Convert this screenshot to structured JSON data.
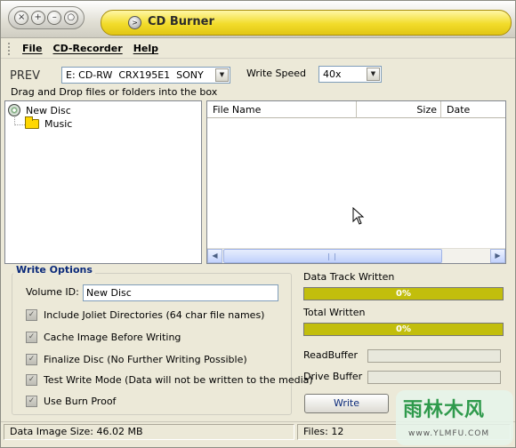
{
  "window": {
    "title": "CD Burner",
    "window_buttons": [
      "×",
      "+",
      "–",
      "○"
    ]
  },
  "menu": [
    "File",
    "CD-Recorder",
    "Help"
  ],
  "toolbar": {
    "prev_label": "PREV",
    "drive": "E: CD-RW  CRX195E1  SONY",
    "write_speed_label": "Write Speed",
    "write_speed": "40x"
  },
  "drag_drop_hint": "Drag and Drop files or folders into the box",
  "tree": {
    "root": "New Disc",
    "children": [
      "Music"
    ]
  },
  "file_list": {
    "columns": [
      "File Name",
      "Size",
      "Date"
    ]
  },
  "write_options": {
    "title": "Write Options",
    "volume_id_label": "Volume ID:",
    "volume_id_value": "New Disc",
    "checkboxes": [
      {
        "label": "Include Joliet Directories (64 char file names)",
        "checked": true
      },
      {
        "label": "Cache Image Before Writing",
        "checked": true
      },
      {
        "label": "Finalize Disc (No Further Writing Possible)",
        "checked": true
      },
      {
        "label": "Test Write Mode (Data will not be written to the media)",
        "checked": true
      },
      {
        "label": "Use Burn Proof",
        "checked": true
      }
    ]
  },
  "progress": {
    "data_track_label": "Data Track Written",
    "data_track_text": "0%",
    "data_track_value": 0,
    "total_label": "Total Written",
    "total_text": "0%",
    "total_value": 0,
    "read_buffer_label": "ReadBuffer",
    "drive_buffer_label": "Drive Buffer",
    "write_button": "Write"
  },
  "status": {
    "image_size": "Data Image Size: 46.02 MB",
    "files": "Files: 12"
  },
  "watermark": {
    "logo": "雨林木风",
    "url": "www.YLMFU.COM"
  },
  "colors": {
    "title_accent": "#f2dc2b",
    "progress_fill": "#c2be0c",
    "window_bg": "#ece9d8"
  }
}
